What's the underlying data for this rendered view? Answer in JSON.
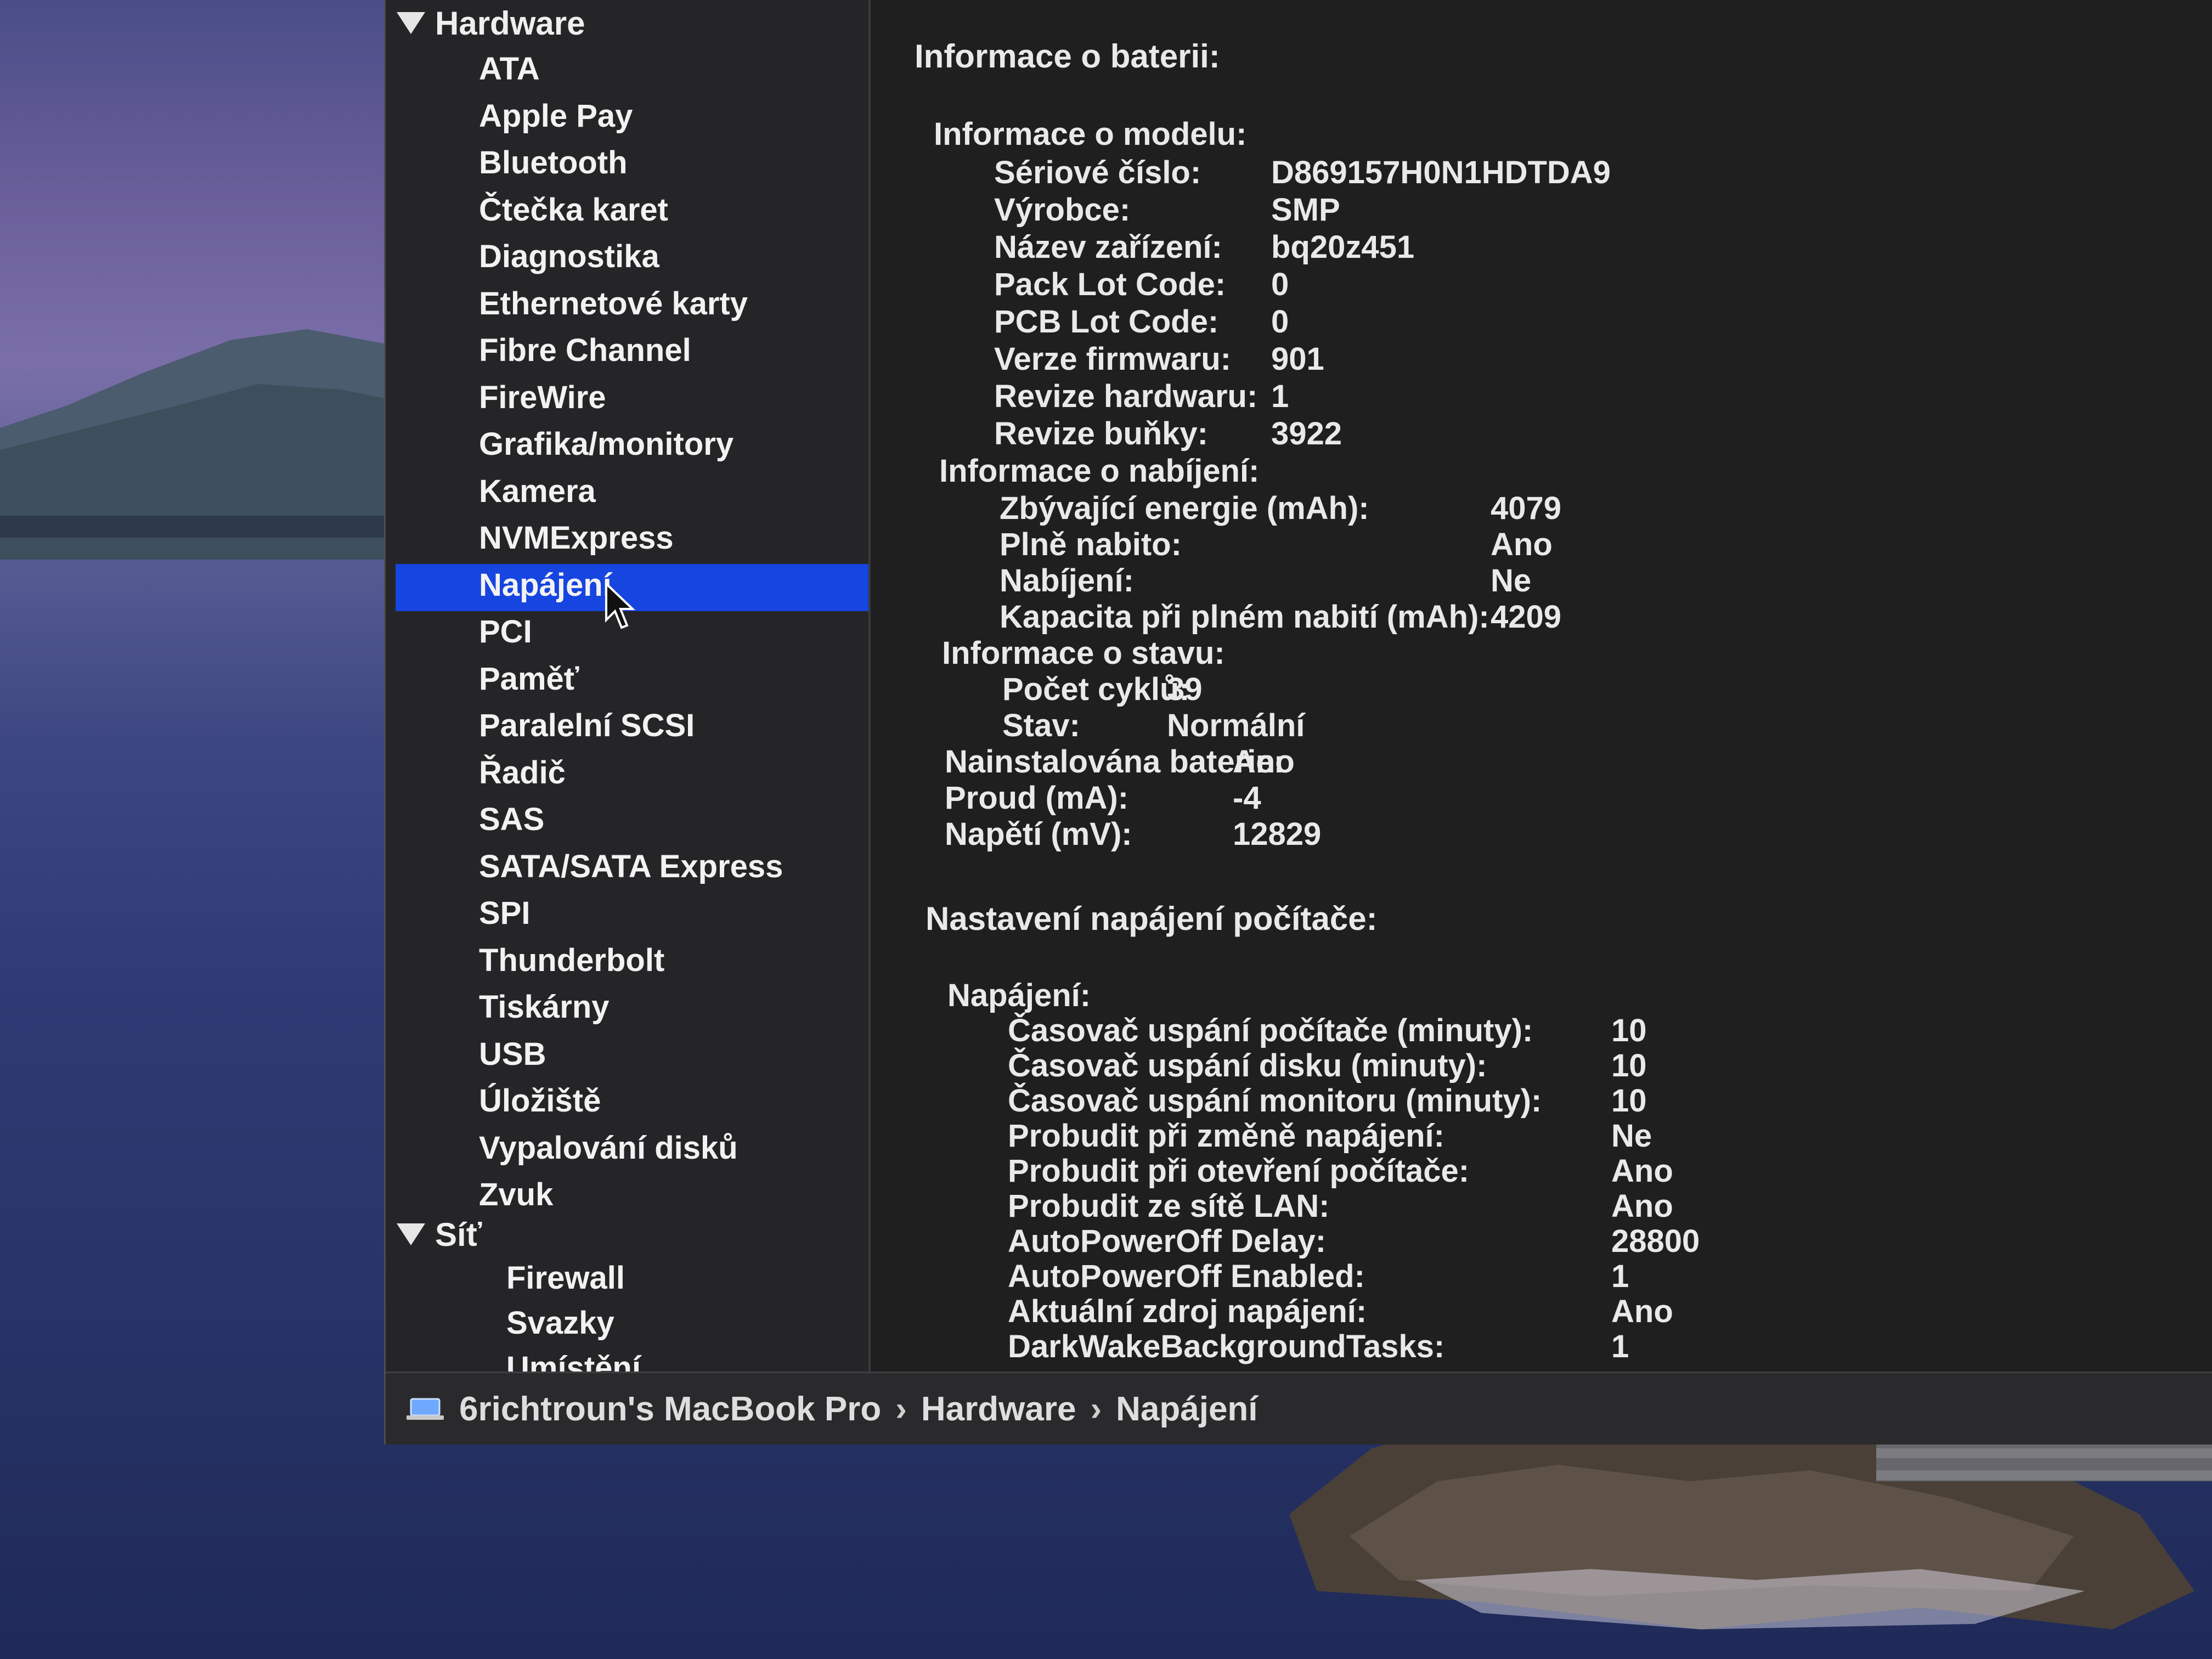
{
  "sidebar": {
    "groups": [
      {
        "label": "Hardware"
      },
      {
        "label": "Síť"
      }
    ],
    "hardware_items": [
      {
        "label": "ATA"
      },
      {
        "label": "Apple Pay"
      },
      {
        "label": "Bluetooth"
      },
      {
        "label": "Čtečka karet"
      },
      {
        "label": "Diagnostika"
      },
      {
        "label": "Ethernetové karty"
      },
      {
        "label": "Fibre Channel"
      },
      {
        "label": "FireWire"
      },
      {
        "label": "Grafika/monitory"
      },
      {
        "label": "Kamera"
      },
      {
        "label": "NVMExpress"
      },
      {
        "label": "Napájení",
        "selected": true
      },
      {
        "label": "PCI"
      },
      {
        "label": "Paměť"
      },
      {
        "label": "Paralelní SCSI"
      },
      {
        "label": "Řadič"
      },
      {
        "label": "SAS"
      },
      {
        "label": "SATA/SATA Express"
      },
      {
        "label": "SPI"
      },
      {
        "label": "Thunderbolt"
      },
      {
        "label": "Tiskárny"
      },
      {
        "label": "USB"
      },
      {
        "label": "Úložiště"
      },
      {
        "label": "Vypalování disků"
      },
      {
        "label": "Zvuk"
      }
    ],
    "network_items": [
      {
        "label": "Firewall"
      },
      {
        "label": "Svazky"
      },
      {
        "label": "Umístění"
      }
    ],
    "selection_color": "#1745e0"
  },
  "content": {
    "battery_title": "Informace o baterii:",
    "model_info": {
      "title": "Informace o modelu:",
      "rows": [
        {
          "label": "Sériové číslo:",
          "value": "D869157H0N1HDTDA9"
        },
        {
          "label": "Výrobce:",
          "value": "SMP"
        },
        {
          "label": "Název zařízení:",
          "value": "bq20z451"
        },
        {
          "label": "Pack Lot Code:",
          "value": "0"
        },
        {
          "label": "PCB Lot Code:",
          "value": "0"
        },
        {
          "label": "Verze firmwaru:",
          "value": "901"
        },
        {
          "label": "Revize hardwaru:",
          "value": "1"
        },
        {
          "label": "Revize buňky:",
          "value": "3922"
        }
      ]
    },
    "charge_info": {
      "title": "Informace o nabíjení:",
      "rows": [
        {
          "label": "Zbývající energie (mAh):",
          "value": "4079"
        },
        {
          "label": "Plně nabito:",
          "value": "Ano"
        },
        {
          "label": "Nabíjení:",
          "value": "Ne"
        },
        {
          "label": "Kapacita při plném nabití (mAh):",
          "value": "4209"
        }
      ]
    },
    "health_info": {
      "title": "Informace o stavu:",
      "rows": [
        {
          "label": "Počet cyklů:",
          "value": "39"
        },
        {
          "label": "Stav:",
          "value": "Normální"
        }
      ]
    },
    "battery_misc": [
      {
        "label": "Nainstalována baterie:",
        "value": "Ano"
      },
      {
        "label": "Proud (mA):",
        "value": "-4"
      },
      {
        "label": "Napětí (mV):",
        "value": "12829"
      }
    ],
    "power_settings_title": "Nastavení napájení počítače:",
    "power_settings": {
      "title": "Napájení:",
      "rows": [
        {
          "label": "Časovač uspání počítače (minuty):",
          "value": "10"
        },
        {
          "label": "Časovač uspání disku (minuty):",
          "value": "10"
        },
        {
          "label": "Časovač uspání monitoru (minuty):",
          "value": "10"
        },
        {
          "label": "Probudit při změně napájení:",
          "value": "Ne"
        },
        {
          "label": "Probudit při otevření počítače:",
          "value": "Ano"
        },
        {
          "label": "Probudit ze sítě LAN:",
          "value": "Ano"
        },
        {
          "label": "AutoPowerOff Delay:",
          "value": "28800"
        },
        {
          "label": "AutoPowerOff Enabled:",
          "value": "1"
        },
        {
          "label": "Aktuální zdroj napájení:",
          "value": "Ano"
        },
        {
          "label": "DarkWakeBackgroundTasks:",
          "value": "1"
        }
      ]
    }
  },
  "statusbar": {
    "computer": "6richtroun's MacBook Pro",
    "separator": "›",
    "section": "Hardware",
    "page": "Napájení"
  }
}
